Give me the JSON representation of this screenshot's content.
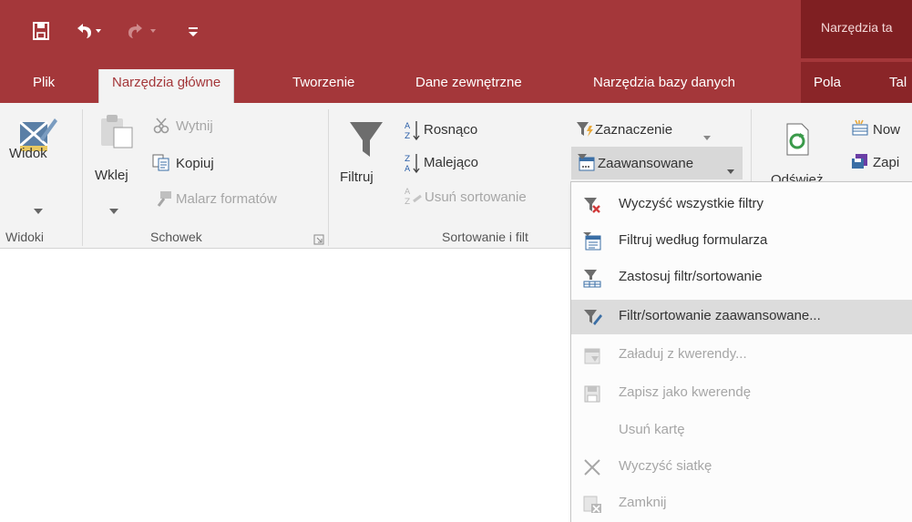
{
  "window": {
    "context_title": "Narzędzia ta"
  },
  "tabs": [
    {
      "label": "Plik",
      "active": false
    },
    {
      "label": "Narzędzia główne",
      "active": true
    },
    {
      "label": "Tworzenie",
      "active": false
    },
    {
      "label": "Dane zewnętrzne",
      "active": false
    },
    {
      "label": "Narzędzia bazy danych",
      "active": false
    },
    {
      "label": "Pola",
      "active": false
    },
    {
      "label": "Tal",
      "active": false
    }
  ],
  "ribbon": {
    "view": {
      "label": "Widok",
      "group": "Widoki"
    },
    "clipboard": {
      "paste": "Wklej",
      "cut": "Wytnij",
      "copy": "Kopiuj",
      "format_painter": "Malarz formatów",
      "group": "Schowek"
    },
    "sort_filter": {
      "filter": "Filtruj",
      "ascending": "Rosnąco",
      "descending": "Malejąco",
      "remove_sort": "Usuń sortowanie",
      "selection": "Zaznaczenie",
      "advanced": "Zaawansowane",
      "group": "Sortowanie i filt"
    },
    "records": {
      "refresh": "Odśwież",
      "new": "Now",
      "save": "Zapi"
    }
  },
  "menu": {
    "items": [
      {
        "label": "Wyczyść wszystkie filtry",
        "enabled": true,
        "highlighted": false,
        "icon": "clear-filter-icon"
      },
      {
        "label": "Filtruj według formularza",
        "enabled": true,
        "highlighted": false,
        "icon": "filter-by-form-icon"
      },
      {
        "label": "Zastosuj filtr/sortowanie",
        "enabled": true,
        "highlighted": false,
        "icon": "apply-filter-icon"
      },
      {
        "label": "Filtr/sortowanie zaawansowane...",
        "enabled": true,
        "highlighted": true,
        "icon": "advanced-filter-icon"
      },
      {
        "label": "Załaduj z kwerendy...",
        "enabled": false,
        "highlighted": false,
        "icon": "load-query-icon"
      },
      {
        "label": "Zapisz jako kwerendę",
        "enabled": false,
        "highlighted": false,
        "icon": "save-query-icon"
      },
      {
        "label": "Usuń kartę",
        "enabled": false,
        "highlighted": false,
        "icon": ""
      },
      {
        "label": "Wyczyść siatkę",
        "enabled": false,
        "highlighted": false,
        "icon": "clear-grid-icon"
      },
      {
        "label": "Zamknij",
        "enabled": false,
        "highlighted": false,
        "icon": "close-icon"
      }
    ]
  },
  "colors": {
    "accent": "#a4373a",
    "context": "#7f1f22",
    "highlight": "#dcdcdc"
  }
}
